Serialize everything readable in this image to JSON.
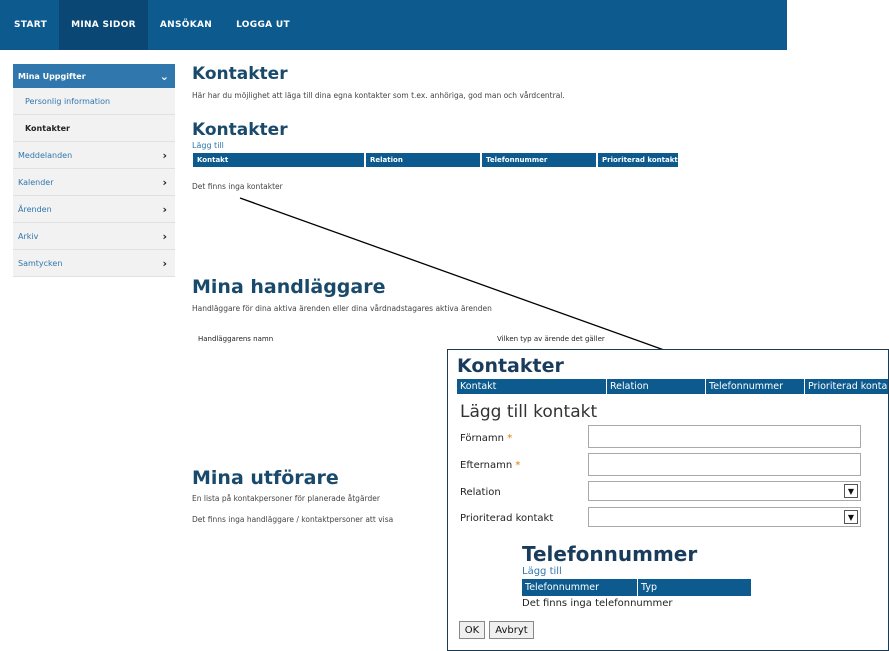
{
  "nav": {
    "items": [
      {
        "label": "START"
      },
      {
        "label": "MINA SIDOR"
      },
      {
        "label": "ANSÖKAN"
      },
      {
        "label": "LOGGA UT"
      }
    ]
  },
  "sidebar": {
    "header": "Mina Uppgifter",
    "sub_items": [
      {
        "label": "Personlig information"
      },
      {
        "label": "Kontakter"
      }
    ],
    "items": [
      {
        "label": "Meddelanden"
      },
      {
        "label": "Kalender"
      },
      {
        "label": "Ärenden"
      },
      {
        "label": "Arkiv"
      },
      {
        "label": "Samtycken"
      }
    ]
  },
  "main": {
    "title": "Kontakter",
    "intro": "Här har du möjlighet att läga till dina egna kontakter som t.ex. anhöriga, god man och vårdcentral.",
    "contacts": {
      "title": "Kontakter",
      "add_link": "Lägg till",
      "columns": [
        "Kontakt",
        "Relation",
        "Telefonnummer",
        "Prioriterad kontakt"
      ],
      "empty": "Det finns inga kontakter"
    },
    "handlers": {
      "title": "Mina handläggare",
      "desc": "Handläggare för dina aktiva ärenden eller dina vårdnadstagares aktiva ärenden",
      "col_name": "Handläggarens namn",
      "col_type": "Vilken typ av ärende det gäller"
    },
    "performers": {
      "title": "Mina utförare",
      "desc": "En lista på kontakpersoner för planerade åtgärder",
      "empty": "Det finns inga handläggare / kontaktpersoner att visa"
    }
  },
  "dialog": {
    "title": "Kontakter",
    "columns": [
      "Kontakt",
      "Relation",
      "Telefonnummer",
      "Prioriterad kontakt"
    ],
    "subtitle": "Lägg till kontakt",
    "fields": {
      "firstname": "Förnamn",
      "lastname": "Efternamn",
      "relation": "Relation",
      "priority": "Prioriterad kontakt",
      "required_mark": "*"
    },
    "phone": {
      "title": "Telefonnummer",
      "add_link": "Lägg till",
      "columns": [
        "Telefonnummer",
        "Typ"
      ],
      "empty": "Det finns inga telefonnummer"
    },
    "ok_label": "OK",
    "cancel_label": "Avbryt"
  }
}
